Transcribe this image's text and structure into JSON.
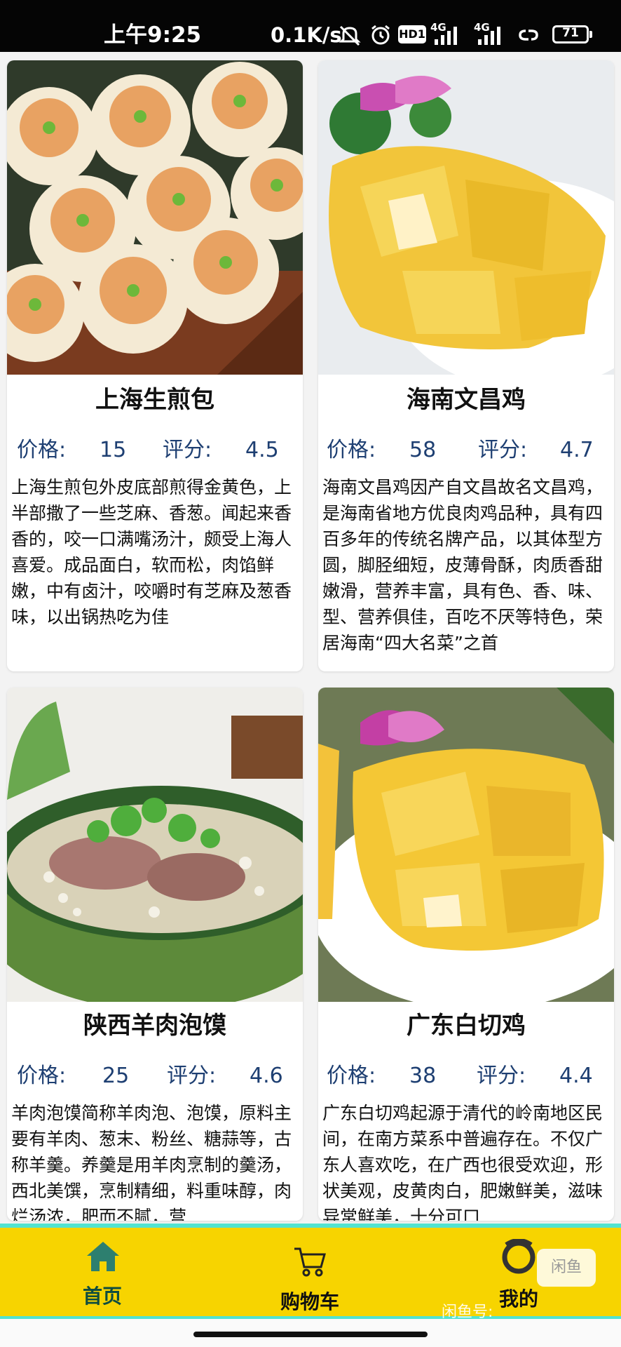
{
  "status_bar": {
    "time": "上午9:25",
    "network_speed": "0.1K/s",
    "battery": "71",
    "hd_label": "HD1",
    "net_label_1": "4G",
    "net_label_2": "4G"
  },
  "cards": [
    {
      "title": "上海生煎包",
      "price_label": "价格:",
      "price": "15",
      "rating_label": "评分:",
      "rating": "4.5",
      "description": "上海生煎包外皮底部煎得金黄色，上半部撒了一些芝麻、香葱。闻起来香香的，咬一口满嘴汤汁，颇受上海人喜爱。成品面白，软而松，肉馅鲜嫩，中有卤汁，咬嚼时有芝麻及葱香味，以出锅热吃为佳"
    },
    {
      "title": "海南文昌鸡",
      "price_label": "价格:",
      "price": "58",
      "rating_label": "评分:",
      "rating": "4.7",
      "description": "海南文昌鸡因产自文昌故名文昌鸡，是海南省地方优良肉鸡品种，具有四百多年的传统名牌产品，以其体型方圆，脚胫细短，皮薄骨酥，肉质香甜嫩滑，营养丰富，具有色、香、味、型、营养俱佳，百吃不厌等特色，荣居海南“四大名菜”之首"
    },
    {
      "title": "陕西羊肉泡馍",
      "price_label": "价格:",
      "price": "25",
      "rating_label": "评分:",
      "rating": "4.6",
      "description": "羊肉泡馍简称羊肉泡、泡馍，原料主要有羊肉、葱末、粉丝、糖蒜等，古称羊羹。养羹是用羊肉烹制的羹汤，西北美馔，烹制精细，料重味醇，肉烂汤浓，肥而不腻，营"
    },
    {
      "title": "广东白切鸡",
      "price_label": "价格:",
      "price": "38",
      "rating_label": "评分:",
      "rating": "4.4",
      "description": "广东白切鸡起源于清代的岭南地区民间，在南方菜系中普遍存在。不仅广东人喜欢吃，在广西也很受欢迎，形状美观，皮黄肉白，肥嫩鲜美，滋味异常鲜美，十分可口"
    }
  ],
  "nav": {
    "home_label": "首页",
    "cart_label": "购物车",
    "profile_label": "我的"
  },
  "watermark": {
    "box_text": "闲鱼",
    "text": "闲鱼号:"
  },
  "colors": {
    "nav_background": "#f7d400",
    "nav_border": "#52e3d0",
    "meta_text": "#1e3f72",
    "home_icon": "#2d7f6f"
  }
}
